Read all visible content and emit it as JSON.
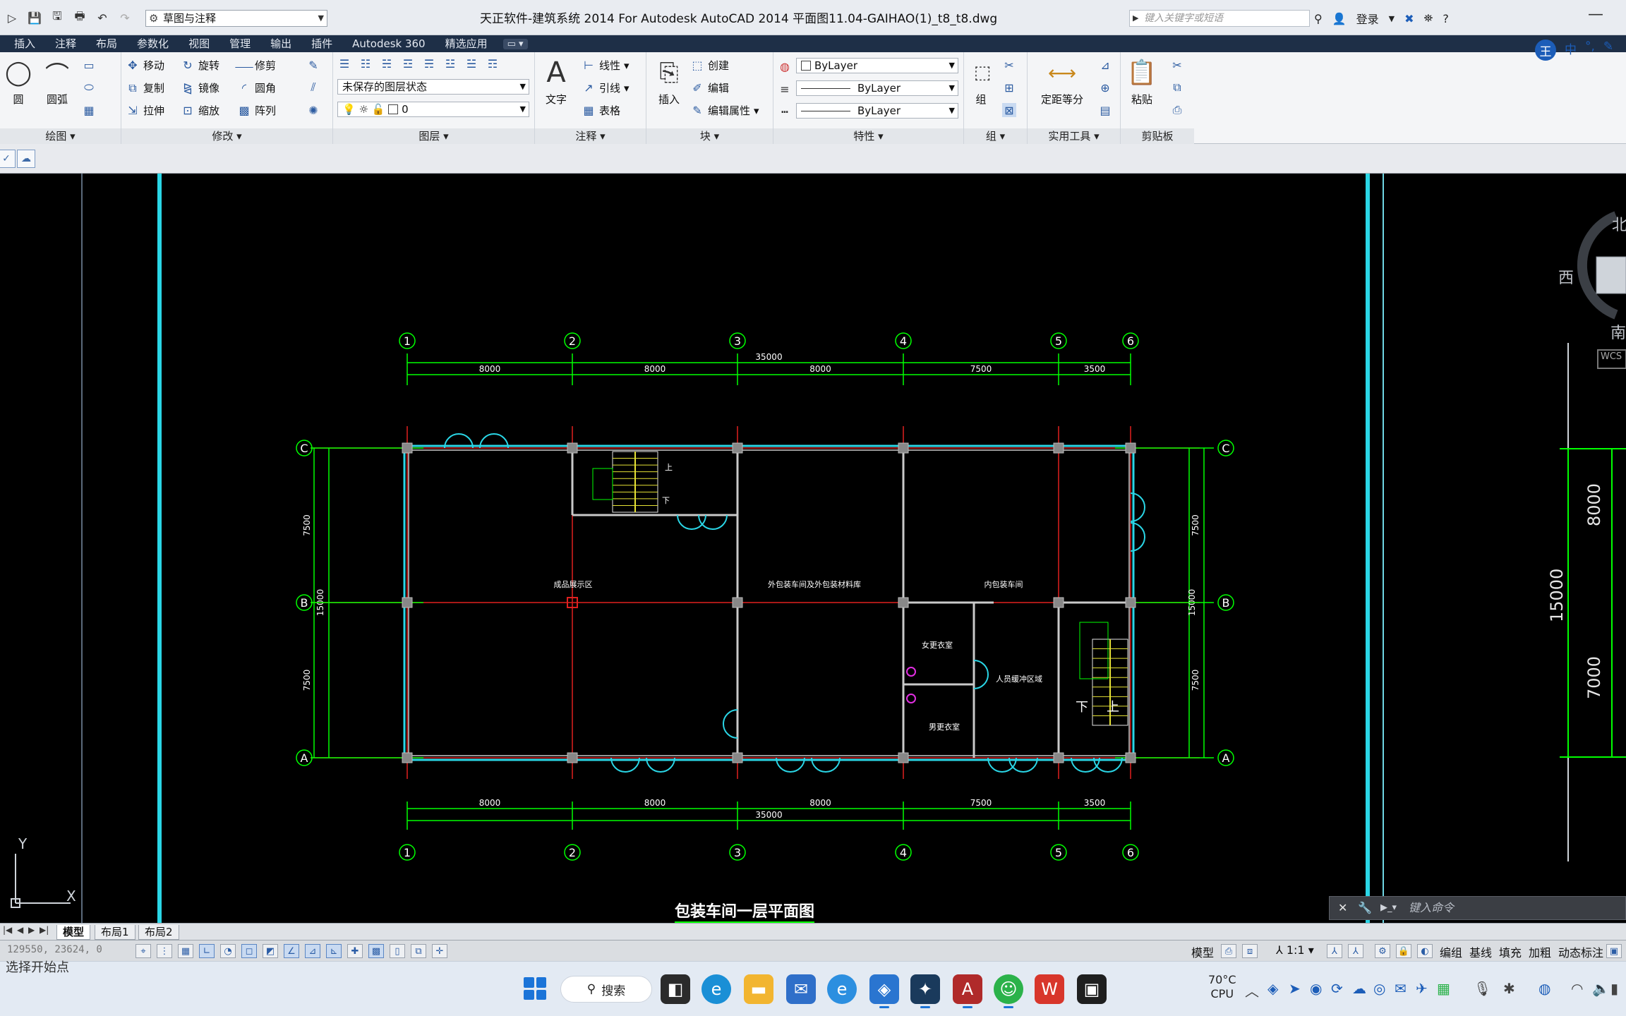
{
  "titlebar": {
    "workspace": "草图与注释",
    "app_title": "天正软件-建筑系统 2014  For Autodesk AutoCAD 2014       平面图11.04-GAIHAO(1)_t8_t8.dwg",
    "search_placeholder": "键入关键字或短语",
    "login": "登录"
  },
  "ribbon_tabs": [
    "插入",
    "注释",
    "布局",
    "参数化",
    "视图",
    "管理",
    "输出",
    "插件",
    "Autodesk 360",
    "精选应用"
  ],
  "ribbon": {
    "draw": {
      "circle": "圆",
      "arc": "圆弧",
      "title": "绘图"
    },
    "modify": {
      "move": "移动",
      "rotate": "旋转",
      "trim": "修剪",
      "copy": "复制",
      "mirror": "镜像",
      "fillet": "圆角",
      "stretch": "拉伸",
      "scale": "缩放",
      "array": "阵列",
      "title": "修改"
    },
    "layers": {
      "state": "未保存的图层状态",
      "current": "0",
      "title": "图层"
    },
    "annotation": {
      "text": "文字",
      "linear": "线性",
      "leader": "引线",
      "table": "表格",
      "title": "注释"
    },
    "block": {
      "insert": "插入",
      "create": "创建",
      "edit": "编辑",
      "edit_attr": "编辑属性",
      "title": "块"
    },
    "properties": {
      "color": "ByLayer",
      "linetype": "ByLayer",
      "lineweight": "ByLayer",
      "title": "特性"
    },
    "groups": {
      "group": "组",
      "title": "组"
    },
    "utilities": {
      "measure": "定距等分",
      "title": "实用工具"
    },
    "clipboard": {
      "paste": "粘贴",
      "title": "剪贴板"
    }
  },
  "ime": {
    "logo": "王",
    "lang": "中"
  },
  "drawing": {
    "title": "包装车间一层平面图",
    "grid_cols": [
      "1",
      "2",
      "3",
      "4",
      "5",
      "6"
    ],
    "grid_rows": [
      "C",
      "B",
      "A"
    ],
    "col_dims": [
      "8000",
      "8000",
      "8000",
      "7500",
      "3500"
    ],
    "total_width": "35000",
    "row_dims": [
      "7500",
      "7500"
    ],
    "total_depth": "15000",
    "rooms": [
      "成品展示区",
      "外包装车间及外包装材料库",
      "内包装车间",
      "女更衣室",
      "男更衣室",
      "人员缓冲区域"
    ],
    "stair_up": "上",
    "stair_down": "下",
    "viewcube": {
      "north": "北",
      "west": "西",
      "south": "南",
      "wcs": "WCS"
    },
    "right_dims": [
      "8000",
      "7000",
      "15000"
    ],
    "ucs": {
      "x": "X",
      "y": "Y"
    }
  },
  "cmdline": {
    "placeholder": "键入命令"
  },
  "layout_tabs": [
    "模型",
    "布局1",
    "布局2"
  ],
  "status": {
    "coords": "129550, 23624, 0",
    "model": "模型",
    "scale": "1:1",
    "tools": [
      "编组",
      "基线",
      "填充",
      "加粗",
      "动态标注"
    ]
  },
  "taskbar": {
    "covered_text": "选择开始点",
    "search": "搜索",
    "temp": "70°C",
    "cpu": "CPU"
  }
}
